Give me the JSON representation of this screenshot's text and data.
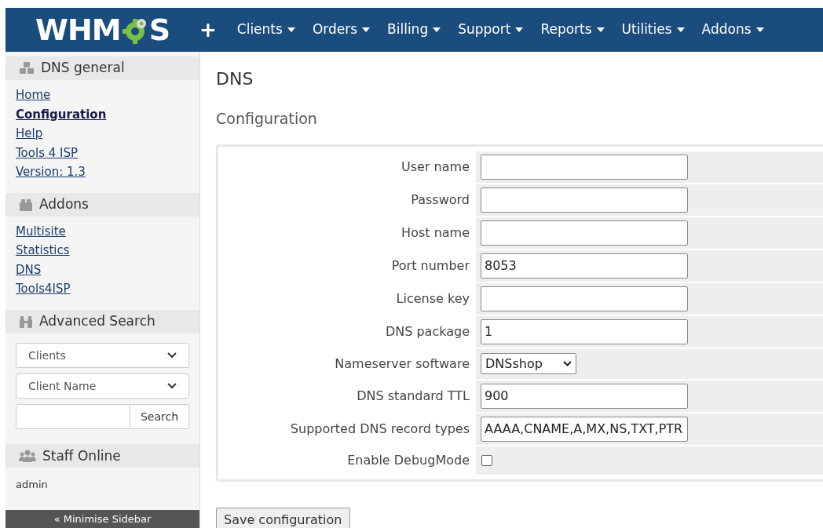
{
  "logo": {
    "before": "WHM",
    "after": "S"
  },
  "nav": {
    "add": "+",
    "items": [
      "Clients",
      "Orders",
      "Billing",
      "Support",
      "Reports",
      "Utilities",
      "Addons"
    ]
  },
  "sidebar": {
    "sections": [
      {
        "title": "DNS general",
        "links": [
          {
            "label": "Home",
            "selected": false
          },
          {
            "label": "Configuration",
            "selected": true
          },
          {
            "label": "Help",
            "selected": false
          },
          {
            "label": "Tools 4 ISP",
            "selected": false
          },
          {
            "label": "Version: 1.3",
            "selected": false
          }
        ]
      },
      {
        "title": "Addons",
        "links": [
          {
            "label": "Multisite",
            "selected": false
          },
          {
            "label": "Statistics",
            "selected": false
          },
          {
            "label": "DNS",
            "selected": false
          },
          {
            "label": "Tools4ISP",
            "selected": false
          }
        ]
      },
      {
        "title": "Advanced Search",
        "search": {
          "type": "Clients",
          "field": "Client Name",
          "button": "Search"
        }
      },
      {
        "title": "Staff Online",
        "text": "admin"
      }
    ],
    "minimise": "« Minimise Sidebar"
  },
  "page": {
    "title": "DNS",
    "subtitle": "Configuration"
  },
  "form": {
    "fields": [
      {
        "label": "User name",
        "kind": "text"
      },
      {
        "label": "Password",
        "kind": "text"
      },
      {
        "label": "Host name",
        "kind": "text"
      },
      {
        "label": "Port number",
        "kind": "text",
        "value": "8053"
      },
      {
        "label": "License key",
        "kind": "text"
      },
      {
        "label": "DNS package",
        "kind": "text",
        "value": "1"
      },
      {
        "label": "Nameserver software",
        "kind": "select",
        "value": "DNSshop"
      },
      {
        "label": "DNS standard TTL",
        "kind": "text",
        "value": "900"
      },
      {
        "label": "Supported DNS record types",
        "kind": "text",
        "value": "AAAA,CNAME,A,MX,NS,TXT,PTR"
      },
      {
        "label": "Enable DebugMode",
        "kind": "checkbox",
        "checked": false
      }
    ],
    "save": "Save configuration"
  }
}
